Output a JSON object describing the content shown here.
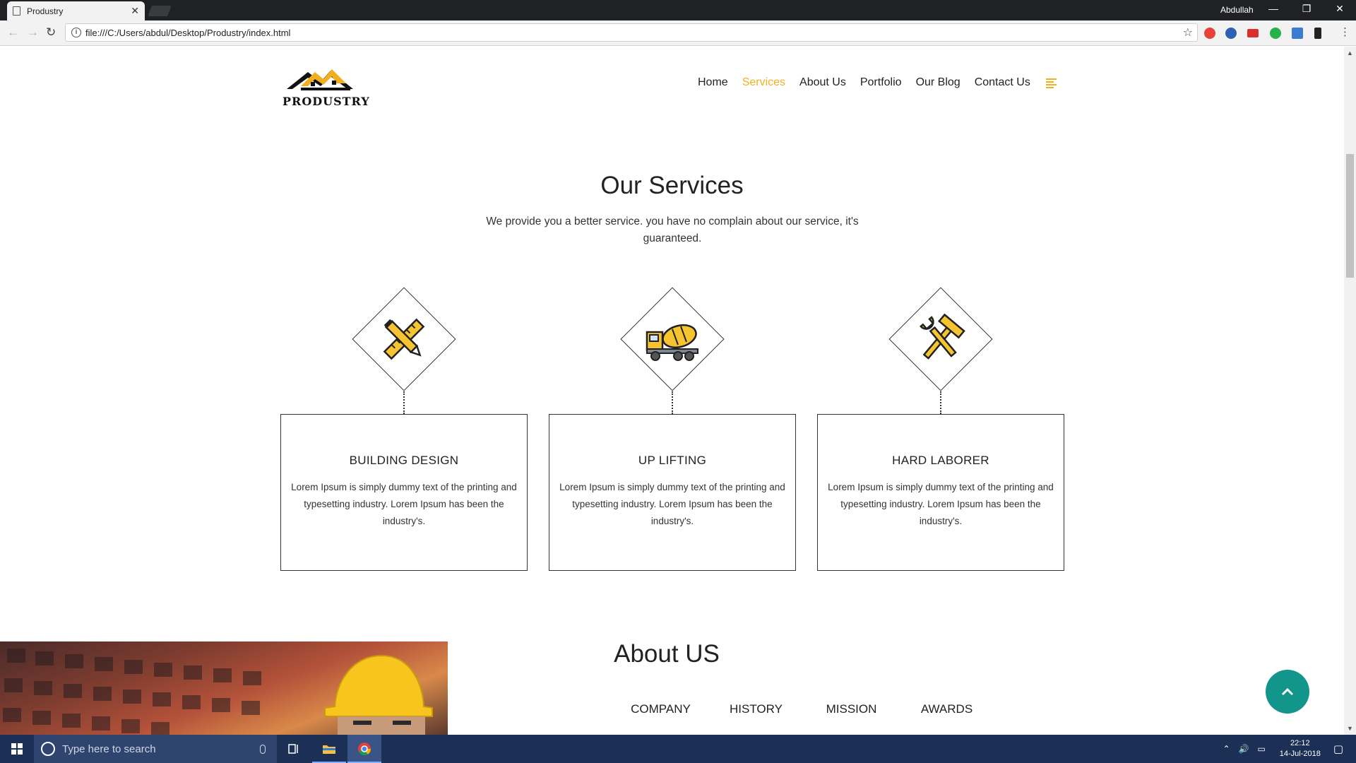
{
  "browser": {
    "tab_title": "Produstry",
    "tab_close": "✕",
    "profile_name": "Abdullah",
    "url": "file:///C:/Users/abdul/Desktop/Produstry/index.html",
    "window_controls": {
      "minimize": "—",
      "restore": "❐",
      "close": "✕"
    }
  },
  "header": {
    "logo_text": "PRODUSTRY",
    "nav": [
      {
        "label": "Home",
        "active": false
      },
      {
        "label": "Services",
        "active": true
      },
      {
        "label": "About Us",
        "active": false
      },
      {
        "label": "Portfolio",
        "active": false
      },
      {
        "label": "Our Blog",
        "active": false
      },
      {
        "label": "Contact Us",
        "active": false
      }
    ],
    "menu_icon": "hamburger-icon"
  },
  "services": {
    "title": "Our Services",
    "subtitle": "We provide you a better service. you have no complain about our service, it's guaranteed.",
    "items": [
      {
        "icon": "pencil-ruler-icon",
        "title": "BUILDING DESIGN",
        "text": "Lorem Ipsum is simply dummy text of the printing and typesetting industry. Lorem Ipsum has been the industry's."
      },
      {
        "icon": "concrete-mixer-truck-icon",
        "title": "UP LIFTING",
        "text": "Lorem Ipsum is simply dummy text of the printing and typesetting industry. Lorem Ipsum has been the industry's."
      },
      {
        "icon": "hammer-wrench-icon",
        "title": "HARD LABORER",
        "text": "Lorem Ipsum is simply dummy text of the printing and typesetting industry. Lorem Ipsum has been the industry's."
      }
    ]
  },
  "about": {
    "title": "About US",
    "tabs": [
      "COMPANY",
      "HISTORY",
      "MISSION",
      "AWARDS"
    ]
  },
  "taskbar": {
    "search_placeholder": "Type here to search",
    "time": "22:12",
    "date": "14-Jul-2018"
  },
  "colors": {
    "accent": "#f2b01e",
    "back_to_top": "#12958a",
    "taskbar": "#1c3056"
  }
}
